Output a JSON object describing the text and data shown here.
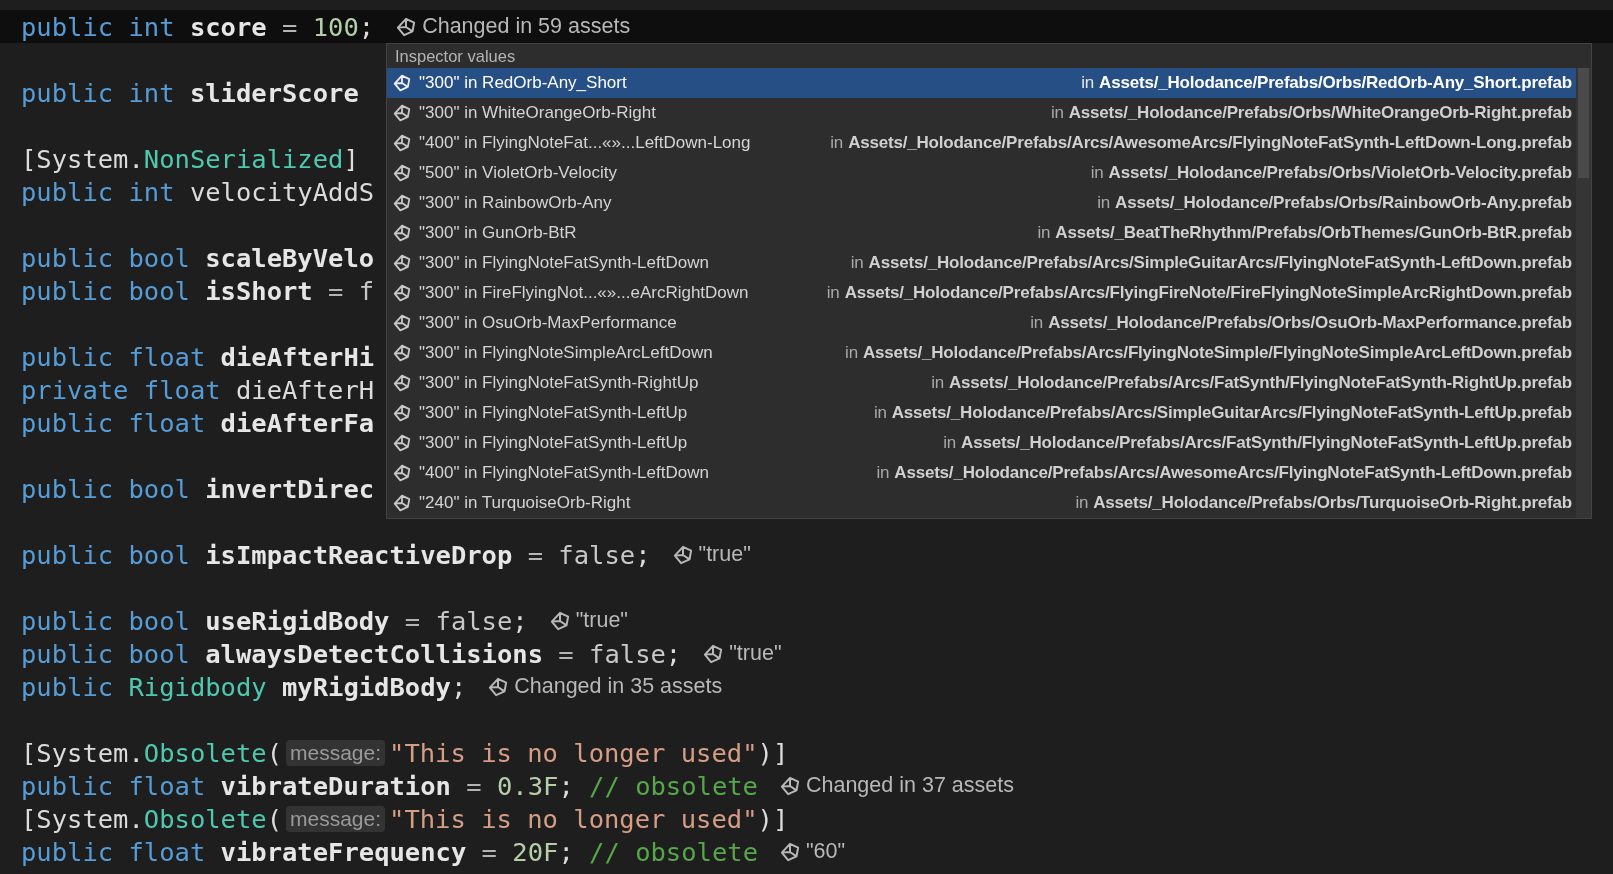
{
  "editor": {
    "lines": [
      {
        "kind": "code",
        "current": true,
        "segments": [
          {
            "kind": "code",
            "tokens": [
              {
                "text": "public",
                "kind": "keyword"
              },
              {
                "text": " int",
                "kind": "keyword"
              },
              {
                "text": " score",
                "kind": "field"
              },
              {
                "text": " =",
                "kind": "operator"
              },
              {
                "text": " 100",
                "kind": "number"
              },
              {
                "text": ";",
                "kind": "plain"
              }
            ]
          }
        ],
        "annotation": "Changed in 59 assets"
      },
      {
        "kind": "blank"
      },
      {
        "kind": "code",
        "current": false,
        "segments": [
          {
            "kind": "code",
            "tokens": [
              {
                "text": "public",
                "kind": "keyword"
              },
              {
                "text": " int",
                "kind": "keyword"
              },
              {
                "text": " sliderScore",
                "kind": "field"
              }
            ]
          }
        ]
      },
      {
        "kind": "blank"
      },
      {
        "kind": "code",
        "current": false,
        "segments": [
          {
            "kind": "code",
            "tokens": [
              {
                "text": "[System.",
                "kind": "plain"
              },
              {
                "text": "NonSerialized",
                "kind": "type"
              },
              {
                "text": "]",
                "kind": "plain"
              }
            ]
          }
        ]
      },
      {
        "kind": "code",
        "current": false,
        "segments": [
          {
            "kind": "code",
            "tokens": [
              {
                "text": "public",
                "kind": "keyword"
              },
              {
                "text": " int",
                "kind": "keyword"
              },
              {
                "text": " velocityAddS",
                "kind": "plain"
              }
            ]
          }
        ]
      },
      {
        "kind": "blank"
      },
      {
        "kind": "code",
        "current": false,
        "segments": [
          {
            "kind": "code",
            "tokens": [
              {
                "text": "public",
                "kind": "keyword"
              },
              {
                "text": " bool",
                "kind": "keyword"
              },
              {
                "text": " scaleByVelo",
                "kind": "field"
              }
            ]
          }
        ]
      },
      {
        "kind": "code",
        "current": false,
        "segments": [
          {
            "kind": "code",
            "tokens": [
              {
                "text": "public",
                "kind": "keyword"
              },
              {
                "text": " bool",
                "kind": "keyword"
              },
              {
                "text": " isShort",
                "kind": "field"
              },
              {
                "text": " =",
                "kind": "operator"
              },
              {
                "text": " f",
                "kind": "literal"
              }
            ]
          }
        ]
      },
      {
        "kind": "blank"
      },
      {
        "kind": "code",
        "current": false,
        "segments": [
          {
            "kind": "code",
            "tokens": [
              {
                "text": "public",
                "kind": "keyword"
              },
              {
                "text": " float",
                "kind": "keyword"
              },
              {
                "text": " dieAfterHi",
                "kind": "field"
              }
            ]
          }
        ]
      },
      {
        "kind": "code",
        "current": false,
        "segments": [
          {
            "kind": "code",
            "tokens": [
              {
                "text": "private",
                "kind": "keyword"
              },
              {
                "text": " float",
                "kind": "keyword"
              },
              {
                "text": " dieAfterH",
                "kind": "plain"
              }
            ]
          }
        ]
      },
      {
        "kind": "code",
        "current": false,
        "segments": [
          {
            "kind": "code",
            "tokens": [
              {
                "text": "public",
                "kind": "keyword"
              },
              {
                "text": " float",
                "kind": "keyword"
              },
              {
                "text": " dieAfterFa",
                "kind": "field"
              }
            ]
          }
        ]
      },
      {
        "kind": "blank"
      },
      {
        "kind": "code",
        "current": false,
        "segments": [
          {
            "kind": "code",
            "tokens": [
              {
                "text": "public",
                "kind": "keyword"
              },
              {
                "text": " bool",
                "kind": "keyword"
              },
              {
                "text": " invertDirec",
                "kind": "field"
              }
            ]
          }
        ]
      },
      {
        "kind": "blank"
      },
      {
        "kind": "code",
        "current": false,
        "segments": [
          {
            "kind": "code",
            "tokens": [
              {
                "text": "public",
                "kind": "keyword"
              },
              {
                "text": " bool",
                "kind": "keyword"
              },
              {
                "text": " isImpactReactiveDrop",
                "kind": "field"
              },
              {
                "text": " =",
                "kind": "operator"
              },
              {
                "text": " false",
                "kind": "literal"
              },
              {
                "text": ";",
                "kind": "plain"
              }
            ]
          }
        ],
        "annotation": "\"true\""
      },
      {
        "kind": "blank"
      },
      {
        "kind": "code",
        "current": false,
        "segments": [
          {
            "kind": "code",
            "tokens": [
              {
                "text": "public",
                "kind": "keyword"
              },
              {
                "text": " bool",
                "kind": "keyword"
              },
              {
                "text": " useRigidBody",
                "kind": "field"
              },
              {
                "text": " =",
                "kind": "operator"
              },
              {
                "text": " false",
                "kind": "literal"
              },
              {
                "text": ";",
                "kind": "plain"
              }
            ]
          }
        ],
        "annotation": "\"true\""
      },
      {
        "kind": "code",
        "current": false,
        "segments": [
          {
            "kind": "code",
            "tokens": [
              {
                "text": "public",
                "kind": "keyword"
              },
              {
                "text": " bool",
                "kind": "keyword"
              },
              {
                "text": " alwaysDetectCollisions",
                "kind": "field"
              },
              {
                "text": " =",
                "kind": "operator"
              },
              {
                "text": " false",
                "kind": "literal"
              },
              {
                "text": ";",
                "kind": "plain"
              }
            ]
          }
        ],
        "annotation": "\"true\""
      },
      {
        "kind": "code",
        "current": false,
        "segments": [
          {
            "kind": "code",
            "tokens": [
              {
                "text": "public",
                "kind": "keyword"
              },
              {
                "text": " Rigidbody",
                "kind": "type"
              },
              {
                "text": " myRigidBody",
                "kind": "field"
              },
              {
                "text": ";",
                "kind": "plain"
              }
            ]
          }
        ],
        "annotation": "Changed in 35 assets"
      },
      {
        "kind": "blank"
      },
      {
        "kind": "code",
        "current": false,
        "segments": [
          {
            "kind": "code",
            "tokens": [
              {
                "text": "[System.",
                "kind": "plain"
              },
              {
                "text": "Obsolete",
                "kind": "type"
              },
              {
                "text": "(",
                "kind": "plain"
              }
            ]
          },
          {
            "kind": "param_hint",
            "text": "message:"
          },
          {
            "kind": "code",
            "tokens": [
              {
                "text": "\"This is no longer used\"",
                "kind": "string"
              },
              {
                "text": ")]",
                "kind": "plain"
              }
            ]
          }
        ]
      },
      {
        "kind": "code",
        "current": false,
        "segments": [
          {
            "kind": "code",
            "tokens": [
              {
                "text": "public",
                "kind": "keyword"
              },
              {
                "text": " float",
                "kind": "keyword"
              },
              {
                "text": " vibrateDuration",
                "kind": "field"
              },
              {
                "text": " =",
                "kind": "operator"
              },
              {
                "text": " 0.3F",
                "kind": "number"
              },
              {
                "text": ";",
                "kind": "plain"
              },
              {
                "text": " // obsolete",
                "kind": "comment"
              }
            ]
          }
        ],
        "annotation": "Changed in 37 assets"
      },
      {
        "kind": "code",
        "current": false,
        "segments": [
          {
            "kind": "code",
            "tokens": [
              {
                "text": "[System.",
                "kind": "plain"
              },
              {
                "text": "Obsolete",
                "kind": "type"
              },
              {
                "text": "(",
                "kind": "plain"
              }
            ]
          },
          {
            "kind": "param_hint",
            "text": "message:"
          },
          {
            "kind": "code",
            "tokens": [
              {
                "text": "\"This is no longer used\"",
                "kind": "string"
              },
              {
                "text": ")]",
                "kind": "plain"
              }
            ]
          }
        ]
      },
      {
        "kind": "code",
        "current": false,
        "segments": [
          {
            "kind": "code",
            "tokens": [
              {
                "text": "public",
                "kind": "keyword"
              },
              {
                "text": " float",
                "kind": "keyword"
              },
              {
                "text": " vibrateFrequency",
                "kind": "field"
              },
              {
                "text": " =",
                "kind": "operator"
              },
              {
                "text": " 20F",
                "kind": "number"
              },
              {
                "text": ";",
                "kind": "plain"
              },
              {
                "text": " // obsolete",
                "kind": "comment"
              }
            ]
          }
        ],
        "annotation": "\"60\""
      }
    ]
  },
  "popup": {
    "title": "Inspector values",
    "items": [
      {
        "selected": true,
        "label": "\"300\" in RedOrb-Any_Short",
        "in": "in",
        "path": "Assets/_Holodance/Prefabs/Orbs/RedOrb-Any_Short.prefab"
      },
      {
        "selected": false,
        "label": "\"300\" in WhiteOrangeOrb-Right",
        "in": "in",
        "path": "Assets/_Holodance/Prefabs/Orbs/WhiteOrangeOrb-Right.prefab"
      },
      {
        "selected": false,
        "label": "\"400\" in FlyingNoteFat...«»...LeftDown-Long",
        "in": "in",
        "path": "Assets/_Holodance/Prefabs/Arcs/AwesomeArcs/FlyingNoteFatSynth-LeftDown-Long.prefab"
      },
      {
        "selected": false,
        "label": "\"500\" in VioletOrb-Velocity",
        "in": "in",
        "path": "Assets/_Holodance/Prefabs/Orbs/VioletOrb-Velocity.prefab"
      },
      {
        "selected": false,
        "label": "\"300\" in RainbowOrb-Any",
        "in": "in",
        "path": "Assets/_Holodance/Prefabs/Orbs/RainbowOrb-Any.prefab"
      },
      {
        "selected": false,
        "label": "\"300\" in GunOrb-BtR",
        "in": "in",
        "path": "Assets/_BeatTheRhythm/Prefabs/OrbThemes/GunOrb-BtR.prefab"
      },
      {
        "selected": false,
        "label": "\"300\" in FlyingNoteFatSynth-LeftDown",
        "in": "in",
        "path": "Assets/_Holodance/Prefabs/Arcs/SimpleGuitarArcs/FlyingNoteFatSynth-LeftDown.prefab"
      },
      {
        "selected": false,
        "label": "\"300\" in FireFlyingNot...«»...eArcRightDown",
        "in": "in",
        "path": "Assets/_Holodance/Prefabs/Arcs/FlyingFireNote/FireFlyingNoteSimpleArcRightDown.prefab"
      },
      {
        "selected": false,
        "label": "\"300\" in OsuOrb-MaxPerformance",
        "in": "in",
        "path": "Assets/_Holodance/Prefabs/Orbs/OsuOrb-MaxPerformance.prefab"
      },
      {
        "selected": false,
        "label": "\"300\" in FlyingNoteSimpleArcLeftDown",
        "in": "in",
        "path": "Assets/_Holodance/Prefabs/Arcs/FlyingNoteSimple/FlyingNoteSimpleArcLeftDown.prefab"
      },
      {
        "selected": false,
        "label": "\"300\" in FlyingNoteFatSynth-RightUp",
        "in": "in",
        "path": "Assets/_Holodance/Prefabs/Arcs/FatSynth/FlyingNoteFatSynth-RightUp.prefab"
      },
      {
        "selected": false,
        "label": "\"300\" in FlyingNoteFatSynth-LeftUp",
        "in": "in",
        "path": "Assets/_Holodance/Prefabs/Arcs/SimpleGuitarArcs/FlyingNoteFatSynth-LeftUp.prefab"
      },
      {
        "selected": false,
        "label": "\"300\" in FlyingNoteFatSynth-LeftUp",
        "in": "in",
        "path": "Assets/_Holodance/Prefabs/Arcs/FatSynth/FlyingNoteFatSynth-LeftUp.prefab"
      },
      {
        "selected": false,
        "label": "\"400\" in FlyingNoteFatSynth-LeftDown",
        "in": "in",
        "path": "Assets/_Holodance/Prefabs/Arcs/AwesomeArcs/FlyingNoteFatSynth-LeftDown.prefab"
      },
      {
        "selected": false,
        "label": "\"240\" in TurquoiseOrb-Right",
        "in": "in",
        "path": "Assets/_Holodance/Prefabs/Orbs/TurquoiseOrb-Right.prefab"
      }
    ]
  }
}
